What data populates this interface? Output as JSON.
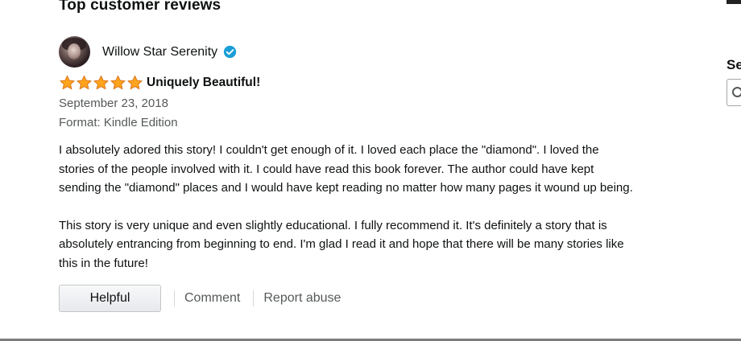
{
  "section_title": "Top customer reviews",
  "reviewer": {
    "name": "Willow Star Serenity",
    "verified_color": "#1a9ed6"
  },
  "review": {
    "rating": 5,
    "rating_max": 5,
    "star_color": "#ffa41c",
    "title": "Uniquely Beautiful!",
    "date": "September 23, 2018",
    "format": "Format: Kindle Edition",
    "paragraphs": [
      [
        "I absolutely adored this story! I couldn't get enough of it. I loved each place the \"diamond\". I loved the",
        "stories of the people involved with it. I could have read this book forever. The author could have kept",
        "sending the \"diamond\" places and I would have kept reading no matter how many pages it wound up being."
      ],
      [
        "This story is very unique and even slightly educational. I fully recommend it. It's definitely a story that is",
        "absolutely entrancing from beginning to end. I'm glad I read it and hope that there will be many stories like",
        "this in the future!"
      ]
    ]
  },
  "actions": {
    "helpful_label": "Helpful",
    "comment_label": "Comment",
    "report_label": "Report abuse"
  },
  "sidebar_partial": {
    "heading": "Se",
    "search_icon": "search-icon"
  }
}
